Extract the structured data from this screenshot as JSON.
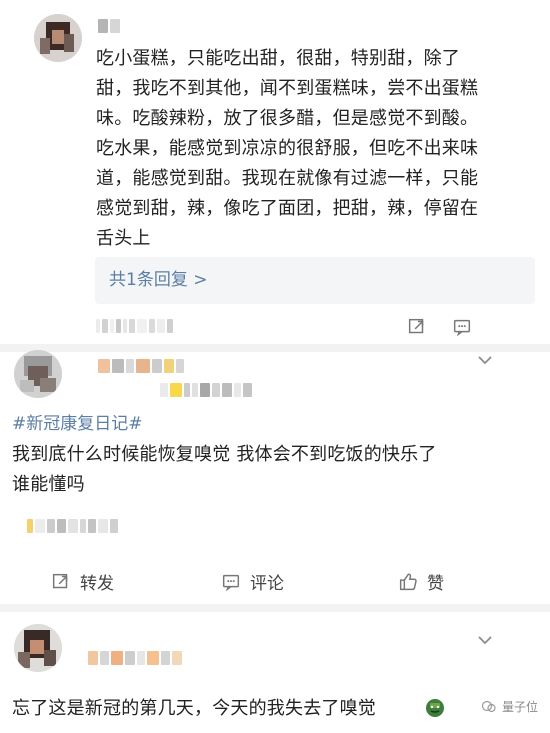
{
  "comments": [
    {
      "text_lines": [
        "吃小蛋糕，只能吃出甜，很甜，特别甜，除了",
        "甜，我吃不到其他，闻不到蛋糕味，尝不出蛋糕",
        "味。吃酸辣粉，放了很多醋，但是感觉不到酸。",
        "吃水果，能感觉到凉凉的很舒服，但吃不出来味",
        "道，能感觉到甜。我现在就像有过滤一样，只能",
        "感觉到甜，辣，像吃了面团，把甜，辣，停留在",
        "舌头上"
      ],
      "replies_link": "共1条回复 >"
    },
    {
      "hashtag": "#新冠康复日记#",
      "text_lines": [
        "我到底什么时候能恢复嗅觉 我体会不到吃饭的快乐了",
        "谁能懂吗"
      ],
      "actions": {
        "repost": "转发",
        "comment": "评论",
        "like": "赞"
      }
    },
    {
      "text_lines": [
        "忘了这是新冠的第几天，今天的我失去了嗅觉"
      ]
    }
  ],
  "watermark": "量子位",
  "icons": {
    "repost": "repost-icon",
    "comment": "comment-icon",
    "like": "thumbs-up-icon",
    "share_small": "share-small-icon",
    "comment_small": "comment-small-icon",
    "dropdown": "chevron-down-icon",
    "emoji": "zombie-face-emoji"
  },
  "colors": {
    "text": "#222222",
    "link": "#5b7ea4",
    "divider": "#f2f2f2",
    "reply_bg": "#f4f5f7",
    "watermark": "#8a8a8a"
  }
}
